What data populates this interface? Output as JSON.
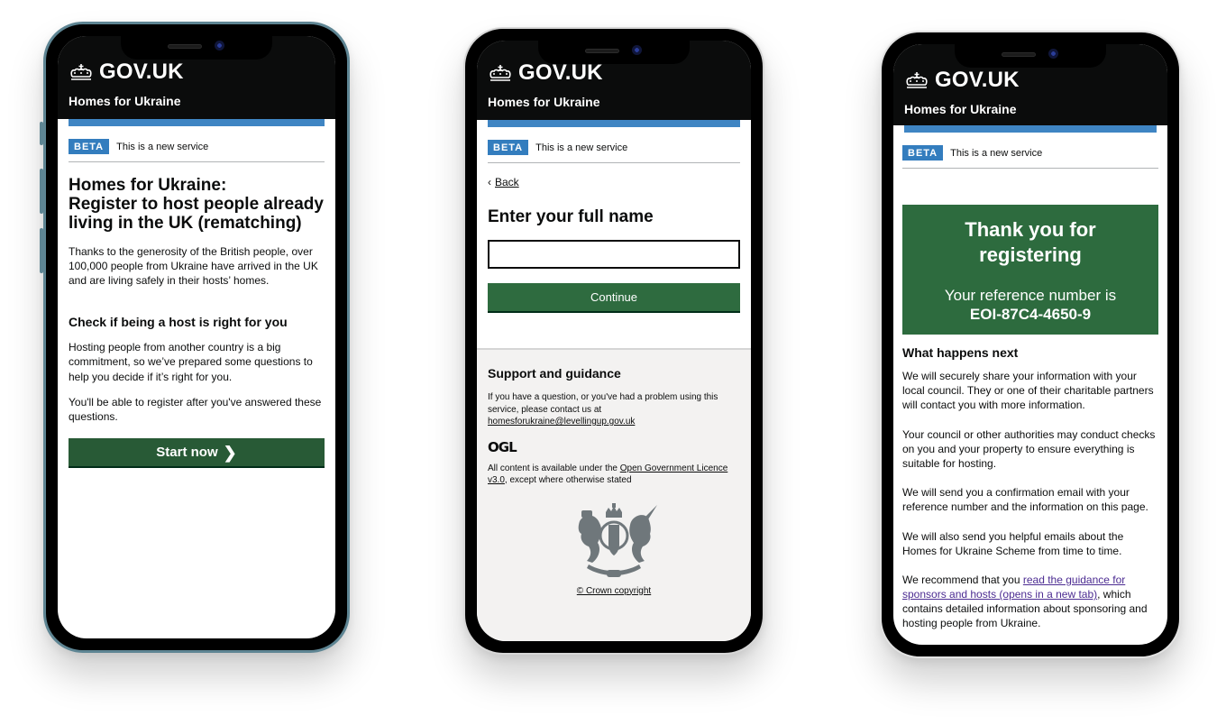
{
  "common": {
    "brand": "GOV.UK",
    "service_name": "Homes for Ukraine",
    "beta_tag": "BETA",
    "beta_text": "This is a new service",
    "crown_icon": "crown-icon",
    "colors": {
      "header_bg": "#0b0c0c",
      "phase_blue": "#1d70b8",
      "button_green": "#285a36",
      "panel_green": "#2d6b3e",
      "link_purple": "#4c2c92",
      "footer_bg": "#f3f2f1"
    }
  },
  "phone1": {
    "title_line1": "Homes for Ukraine:",
    "title_line2": "Register to host people already living in the UK (rematching)",
    "intro": "Thanks to the generosity of the British people, over 100,000 people from Ukraine have arrived in the UK and are living safely in their hosts’ homes.",
    "subheading": "Check if being a host is right for you",
    "para1": "Hosting people from another country is a big commitment, so we’ve prepared some questions to help you decide if it’s right for you.",
    "para2": "You'll be able to register after you've answered these questions.",
    "start_button": "Start now",
    "start_icon": "chevron-right-icon"
  },
  "phone2": {
    "back_link": "Back",
    "question": "Enter your full name",
    "name_input_value": "",
    "continue_button": "Continue",
    "footer": {
      "heading": "Support and guidance",
      "contact_text": "If you have a question, or you've had a problem using this service, please contact us at",
      "contact_email": "homesforukraine@levellingup.gov.uk",
      "ogl_logo": "OGL",
      "licence_prefix": "All content is available under the",
      "licence_link": "Open Government Licence v3.0",
      "licence_suffix": ", except where otherwise stated",
      "crest_icon": "royal-coat-of-arms-icon",
      "copyright": "© Crown copyright"
    }
  },
  "phone3": {
    "panel_title": "Thank you for registering",
    "reference_label": "Your reference number is",
    "reference_number": "EOI-87C4-4650-9",
    "next_heading": "What happens next",
    "paragraphs": [
      "We will securely share your information with your local council. They or one of their charitable partners will contact you with more information.",
      "Your council or other authorities may conduct checks on you and your property to ensure everything is suitable for hosting.",
      "We will send you a confirmation email with your reference number and the information on this page.",
      "We will also send you helpful emails about the Homes for Ukraine Scheme from time to time."
    ],
    "recommend_prefix": "We recommend that you",
    "guidance_link": "read the guidance for sponsors and hosts (opens in a new tab)",
    "recommend_suffix": ", which contains detailed information about sponsoring and hosting people from Ukraine."
  }
}
